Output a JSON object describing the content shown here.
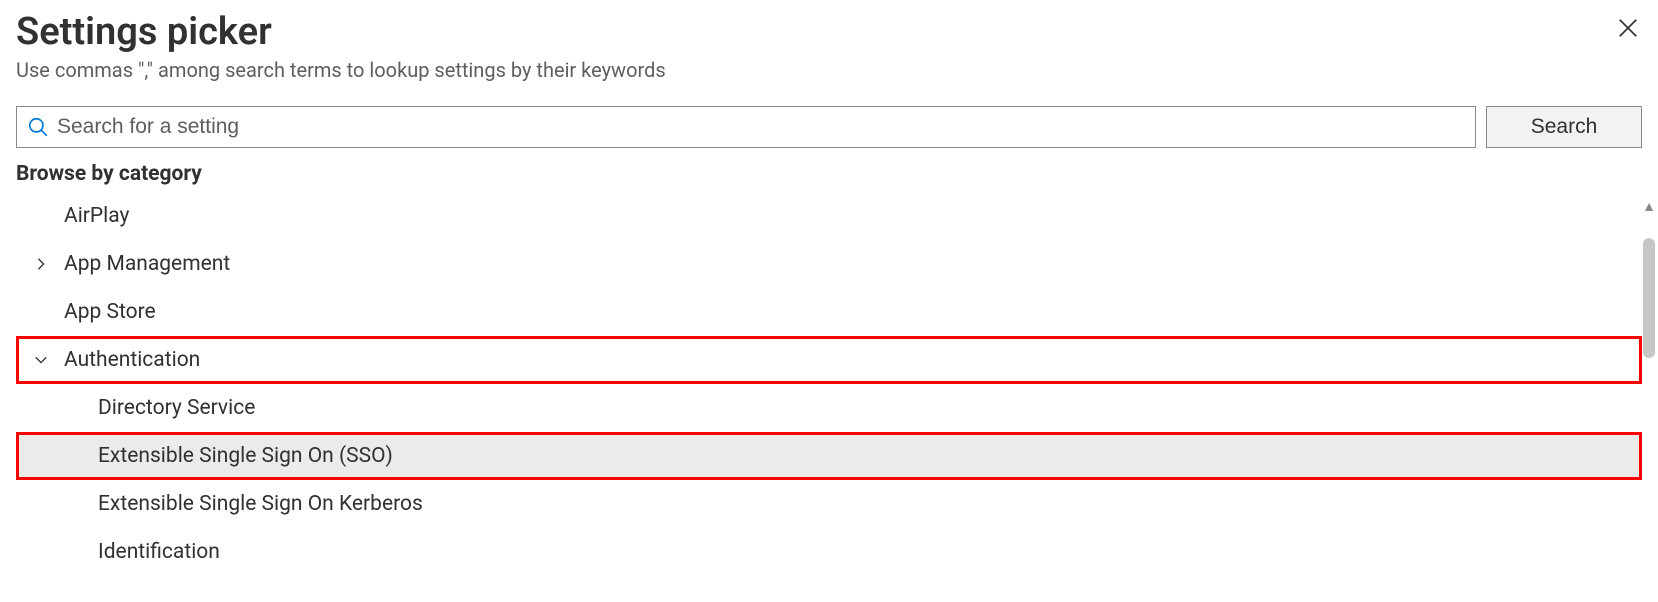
{
  "header": {
    "title": "Settings picker",
    "subtitle": "Use commas \",\" among search terms to lookup settings by their keywords"
  },
  "search": {
    "placeholder": "Search for a setting",
    "button_label": "Search"
  },
  "browse_label": "Browse by category",
  "categories": [
    {
      "label": "AirPlay",
      "expandable": false,
      "level": 0
    },
    {
      "label": "App Management",
      "expandable": true,
      "expanded": false,
      "level": 0
    },
    {
      "label": "App Store",
      "expandable": false,
      "level": 0
    },
    {
      "label": "Authentication",
      "expandable": true,
      "expanded": true,
      "level": 0,
      "highlighted": true
    },
    {
      "label": "Directory Service",
      "expandable": false,
      "level": 1
    },
    {
      "label": "Extensible Single Sign On (SSO)",
      "expandable": false,
      "level": 1,
      "selected": true,
      "highlighted": true
    },
    {
      "label": "Extensible Single Sign On Kerberos",
      "expandable": false,
      "level": 1
    },
    {
      "label": "Identification",
      "expandable": false,
      "level": 1
    }
  ]
}
